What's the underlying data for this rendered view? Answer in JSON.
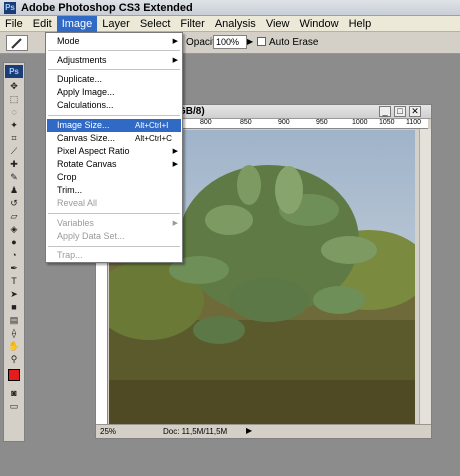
{
  "app": {
    "title": "Adobe Photoshop CS3 Extended",
    "logo_text": "Ps"
  },
  "menubar": [
    "File",
    "Edit",
    "Image",
    "Layer",
    "Select",
    "Filter",
    "Analysis",
    "View",
    "Window",
    "Help"
  ],
  "options_bar": {
    "opacity_label": "Opacity:",
    "opacity_value": "100%",
    "auto_erase_label": "Auto Erase"
  },
  "toolbox": {
    "logo_text": "Ps",
    "foreground_color": "#e41c1c"
  },
  "document": {
    "title_suffix": "GB/8)",
    "ruler_top": [
      "800",
      "850",
      "900",
      "950",
      "1000",
      "1050",
      "1100"
    ],
    "zoom": "25%",
    "doc_size": "Doc: 11,5M/11,5M"
  },
  "image_menu": {
    "mode": "Mode",
    "adjustments": "Adjustments",
    "duplicate": "Duplicate...",
    "apply_image": "Apply Image...",
    "calculations": "Calculations...",
    "image_size": "Image Size...",
    "image_size_shortcut": "Alt+Ctrl+I",
    "canvas_size": "Canvas Size...",
    "canvas_size_shortcut": "Alt+Ctrl+C",
    "pixel_aspect_ratio": "Pixel Aspect Ratio",
    "rotate_canvas": "Rotate Canvas",
    "crop": "Crop",
    "trim": "Trim...",
    "reveal_all": "Reveal All",
    "variables": "Variables",
    "apply_data_set": "Apply Data Set...",
    "trap": "Trap..."
  },
  "colors": {
    "menu_highlight": "#316ac5",
    "foreground": "#e41c1c"
  }
}
